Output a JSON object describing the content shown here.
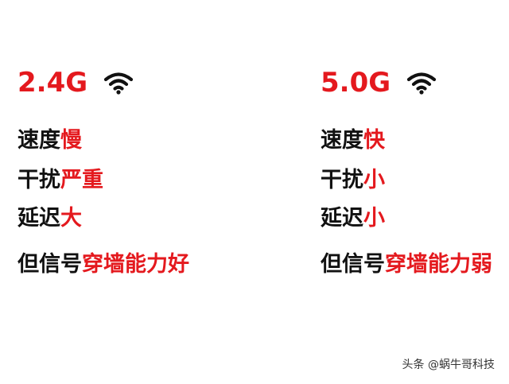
{
  "left": {
    "band": "2.4G",
    "rows": [
      {
        "label": "速度",
        "value": "慢"
      },
      {
        "label": "干扰",
        "value": "严重"
      },
      {
        "label": "延迟",
        "value": "大"
      },
      {
        "label": "但信号",
        "value": "穿墙能力好"
      }
    ]
  },
  "right": {
    "band": "5.0G",
    "rows": [
      {
        "label": "速度",
        "value": "快"
      },
      {
        "label": "干扰",
        "value": "小"
      },
      {
        "label": "延迟",
        "value": "小"
      },
      {
        "label": "但信号",
        "value": "穿墙能力弱"
      }
    ]
  },
  "watermark": "头条 @蜗牛哥科技",
  "colors": {
    "accent": "#e4191e",
    "text": "#111111"
  },
  "icons": {
    "wifi": "wifi-icon"
  }
}
